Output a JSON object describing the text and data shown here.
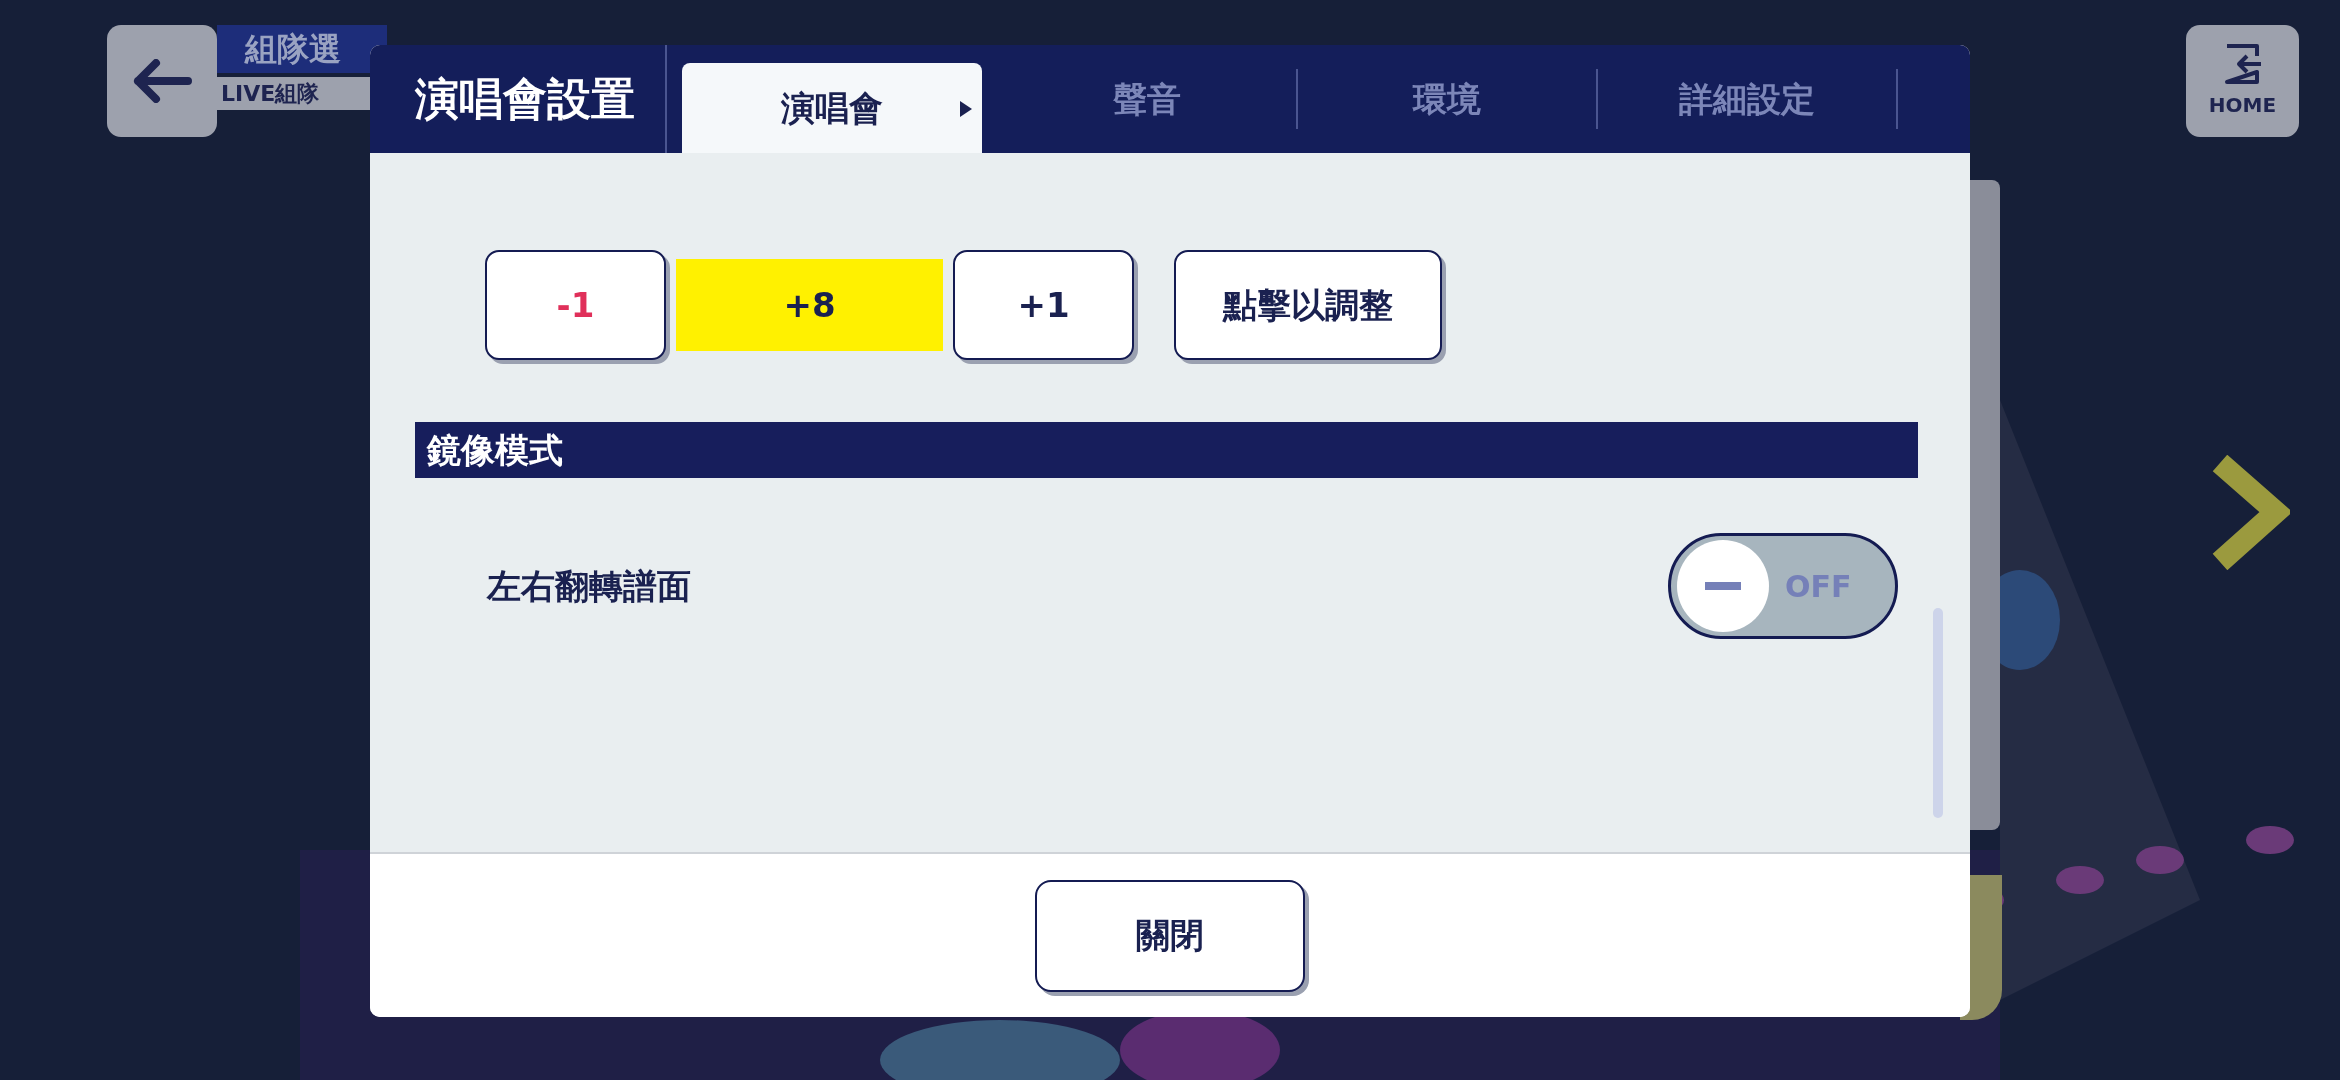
{
  "background": {
    "screen_title": "組隊選",
    "subtitle": "LIVE組隊",
    "home_label": "HOME"
  },
  "dialog": {
    "title": "演唱會設置",
    "tabs": [
      {
        "label": "演唱會",
        "selected": true
      },
      {
        "label": "聲音",
        "selected": false
      },
      {
        "label": "環境",
        "selected": false
      },
      {
        "label": "詳細設定",
        "selected": false
      }
    ],
    "offset": {
      "minus": "-1",
      "value": "+8",
      "plus": "+1",
      "adjust": "點擊以調整"
    },
    "section": "鏡像模式",
    "settings": [
      {
        "label": "左右翻轉譜面",
        "kind": "toggle",
        "on": false,
        "state_text": "OFF"
      }
    ],
    "close_button": "關閉"
  }
}
